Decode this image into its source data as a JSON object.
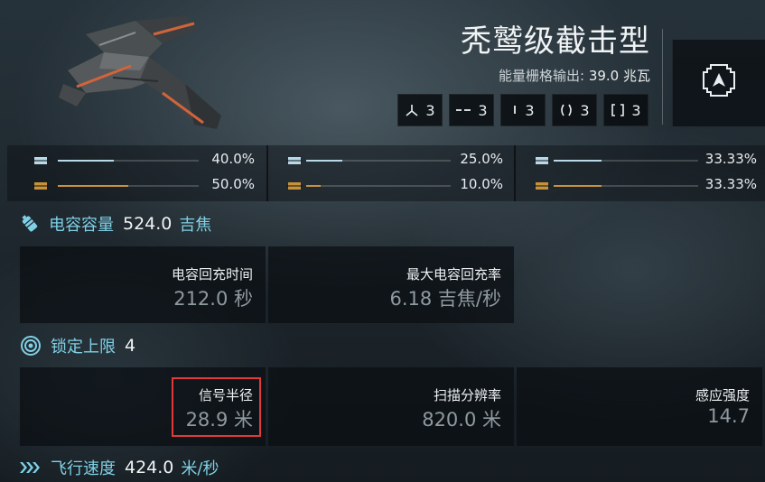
{
  "ship": {
    "name": "秃鹫级截击型",
    "powergrid_label": "能量栅格输出:",
    "powergrid_value": "39.0 兆瓦",
    "type_icon": "interceptor-class-icon"
  },
  "slots": [
    {
      "icon": "turret-hardpoint-icon",
      "count": "3"
    },
    {
      "icon": "launcher-hardpoint-icon",
      "count": "3"
    },
    {
      "icon": "high-slot-icon",
      "count": "3"
    },
    {
      "icon": "mid-slot-icon",
      "count": "3"
    },
    {
      "icon": "low-slot-icon",
      "count": "3"
    }
  ],
  "resistances": {
    "columns": [
      {
        "top_pct": "40.0%",
        "top_level": 0.4,
        "bottom_pct": "50.0%",
        "bottom_level": 0.5
      },
      {
        "top_pct": "25.0%",
        "top_level": 0.25,
        "bottom_pct": "10.0%",
        "bottom_level": 0.1
      },
      {
        "top_pct": "33.33%",
        "top_level": 0.3333,
        "bottom_pct": "33.33%",
        "bottom_level": 0.3333
      }
    ],
    "colors": {
      "top": "#b9d9e6",
      "bottom": "#c8923a"
    }
  },
  "capacitor": {
    "label": "电容容量",
    "value": "524.0",
    "unit": "吉焦",
    "stats": [
      {
        "label": "电容回充时间",
        "value": "212.0 秒"
      },
      {
        "label": "最大电容回充率",
        "value": "6.18 吉焦/秒"
      }
    ]
  },
  "targeting": {
    "label": "锁定上限",
    "value": "4",
    "stats": [
      {
        "label": "信号半径",
        "value": "28.9 米"
      },
      {
        "label": "扫描分辨率",
        "value": "820.0 米"
      },
      {
        "label": "感应强度",
        "value": "14.7"
      }
    ]
  },
  "navigation": {
    "label": "飞行速度",
    "value": "424.0",
    "unit": "米/秒"
  },
  "colors": {
    "accent": "#7fd0e6",
    "highlight": "#e03a3a"
  }
}
